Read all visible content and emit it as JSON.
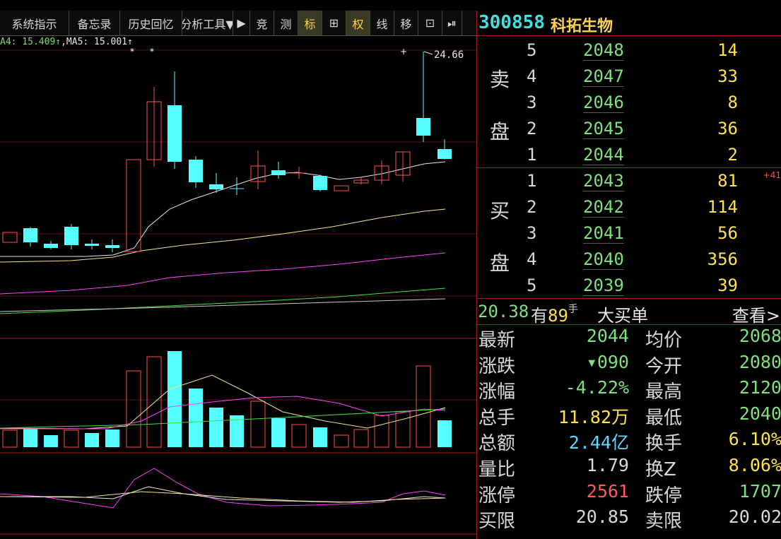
{
  "toolbar": {
    "items": [
      "系统指示",
      "备忘录",
      "历史回忆",
      "分析工具▼",
      "▶",
      "竞",
      "测",
      "标",
      "⊞",
      "权",
      "线",
      "移",
      "⊡",
      "⏯"
    ]
  },
  "chart": {
    "ma_legend": {
      "ma4": "A4: 15.409↑",
      "ma5": ",MA5: 15.001↑"
    },
    "high_label": "24.66"
  },
  "stock": {
    "code": "300858",
    "name": "科拓生物"
  },
  "order_book": {
    "sell_label_1": "卖",
    "sell_label_2": "盘",
    "buy_label_1": "买",
    "buy_label_2": "盘",
    "sell": [
      {
        "level": "5",
        "price": "2048",
        "vol": "14"
      },
      {
        "level": "4",
        "price": "2047",
        "vol": "33"
      },
      {
        "level": "3",
        "price": "2046",
        "vol": "8"
      },
      {
        "level": "2",
        "price": "2045",
        "vol": "36"
      },
      {
        "level": "1",
        "price": "2044",
        "vol": "2"
      }
    ],
    "buy": [
      {
        "level": "1",
        "price": "2043",
        "vol": "81"
      },
      {
        "level": "2",
        "price": "2042",
        "vol": "114"
      },
      {
        "level": "3",
        "price": "2041",
        "vol": "56"
      },
      {
        "level": "4",
        "price": "2040",
        "vol": "356"
      },
      {
        "level": "5",
        "price": "2039",
        "vol": "39"
      }
    ],
    "side_change": "+41"
  },
  "big_buy": {
    "price": "20.38",
    "prefix": "有",
    "qty": "89",
    "unit": "手",
    "label": "大买单",
    "link": "查看>"
  },
  "quote": [
    {
      "l1": "最新",
      "v1": "2044",
      "c1": "#7ee07e",
      "l2": "均价",
      "v2": "2068",
      "c2": "#7ee07e"
    },
    {
      "l1": "涨跌",
      "v1": "▾090",
      "c1": "#7ee07e",
      "l2": "今开",
      "v2": "2080",
      "c2": "#7ee07e"
    },
    {
      "l1": "涨幅",
      "v1": "-4.22%",
      "c1": "#7ee07e",
      "l2": "最高",
      "v2": "2120",
      "c2": "#7ee07e"
    },
    {
      "l1": "总手",
      "v1": "11.82万",
      "c1": "#ffe14a",
      "l2": "最低",
      "v2": "2040",
      "c2": "#7ee07e"
    },
    {
      "l1": "总额",
      "v1": "2.44亿",
      "c1": "#5fd6ff",
      "l2": "换手",
      "v2": "6.10%",
      "c2": "#ffe14a"
    },
    {
      "l1": "量比",
      "v1": "1.79",
      "c1": "#d8d8d8",
      "l2": "换Z",
      "v2": "8.06%",
      "c2": "#ffe14a"
    },
    {
      "l1": "涨停",
      "v1": "2561",
      "c1": "#ff5a5a",
      "l2": "跌停",
      "v2": "1707",
      "c2": "#7ee07e"
    },
    {
      "l1": "买限",
      "v1": "20.85",
      "c1": "#d8d8d8",
      "l2": "卖限",
      "v2": "20.02",
      "c2": "#d8d8d8"
    }
  ]
}
